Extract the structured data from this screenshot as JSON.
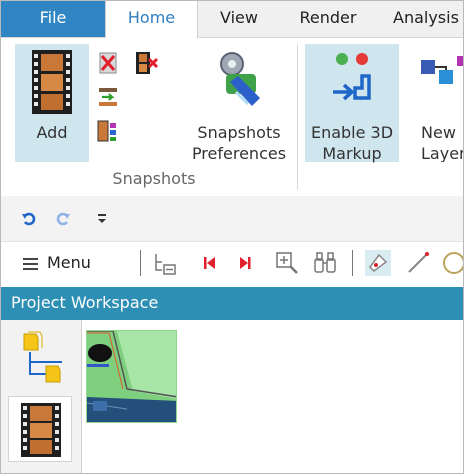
{
  "ribbon_tabs": {
    "file": "File",
    "home": "Home",
    "view": "View",
    "render": "Render",
    "analysis": "Analysis"
  },
  "ribbon": {
    "add_label": "Add",
    "snapshots_prefs_line1": "Snapshots",
    "snapshots_prefs_line2": "Preferences",
    "enable3d_line1": "Enable 3D",
    "enable3d_line2": "Markup",
    "new_layer_line1": "New",
    "new_layer_line2": "Layer",
    "group_label": "Snapshots"
  },
  "toolbar": {
    "menu_label": "Menu"
  },
  "workspace": {
    "title": "Project Workspace"
  },
  "colors": {
    "file_tab": "#2f86c2",
    "workspace_header": "#2e8fb5",
    "selected_button": "#cfe6ef"
  },
  "icons": [
    "film-add-icon",
    "delete-snapshot-icon",
    "film-delete-icon",
    "rename-icon",
    "organize-icon",
    "snapshot-preferences-icon",
    "enable-3d-markup-icon",
    "new-layer-icon",
    "undo-icon",
    "redo-icon",
    "customize-dropdown-icon",
    "hamburger-icon",
    "tree-icon",
    "first-icon",
    "previous-icon",
    "zoom-icon",
    "binoculars-icon",
    "markup-icon",
    "line-icon",
    "circle-icon",
    "tree-view-icon",
    "film-strip-icon"
  ]
}
